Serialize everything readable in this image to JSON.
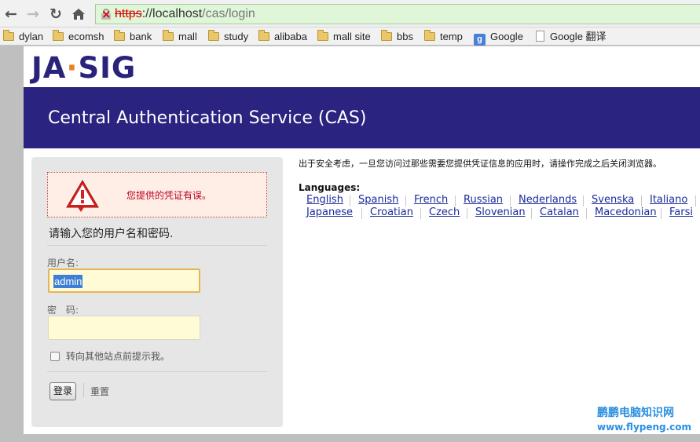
{
  "browser": {
    "url_scheme": "https",
    "url_host": "://localhost",
    "url_path": "/cas/login",
    "bookmarks": [
      "dylan",
      "ecomsh",
      "bank",
      "mall",
      "study",
      "alibaba",
      "mall site",
      "bbs",
      "temp",
      "Google",
      "Google 翻译"
    ]
  },
  "header": {
    "logo_left": "JA",
    "logo_dot": "·",
    "logo_right": "SIG",
    "banner_title": "Central Authentication Service (CAS)"
  },
  "login": {
    "error_message": "您提供的凭证有误。",
    "prompt": "请输入您的用户名和密码.",
    "username_label": "用户名:",
    "username_value": "admin",
    "password_label": "密　码:",
    "password_value": "",
    "warn_label": "转向其他站点前提示我。",
    "submit_label": "登录",
    "reset_label": "重置"
  },
  "sidebar": {
    "notice": "出于安全考虑，一旦您访问过那些需要您提供凭证信息的应用时，请操作完成之后关闭浏览器。",
    "languages_title": "Languages:",
    "languages_row1": [
      "English",
      "Spanish",
      "French",
      "Russian",
      "Nederlands",
      "Svenska",
      "Italiano"
    ],
    "languages_row2": [
      "Japanese",
      "Croatian",
      "Czech",
      "Slovenian",
      "Catalan",
      "Macedonian",
      "Farsi"
    ]
  },
  "watermark": {
    "line1": "鹏鹏电脑知识网",
    "line2": "www.flypeng.com"
  },
  "colors": {
    "banner": "#2a2380",
    "logo": "#2a237a",
    "logo_accent": "#e3842b",
    "error_text": "#b8001f",
    "link": "#1b2b9a",
    "watermark": "#2b8fe0"
  }
}
